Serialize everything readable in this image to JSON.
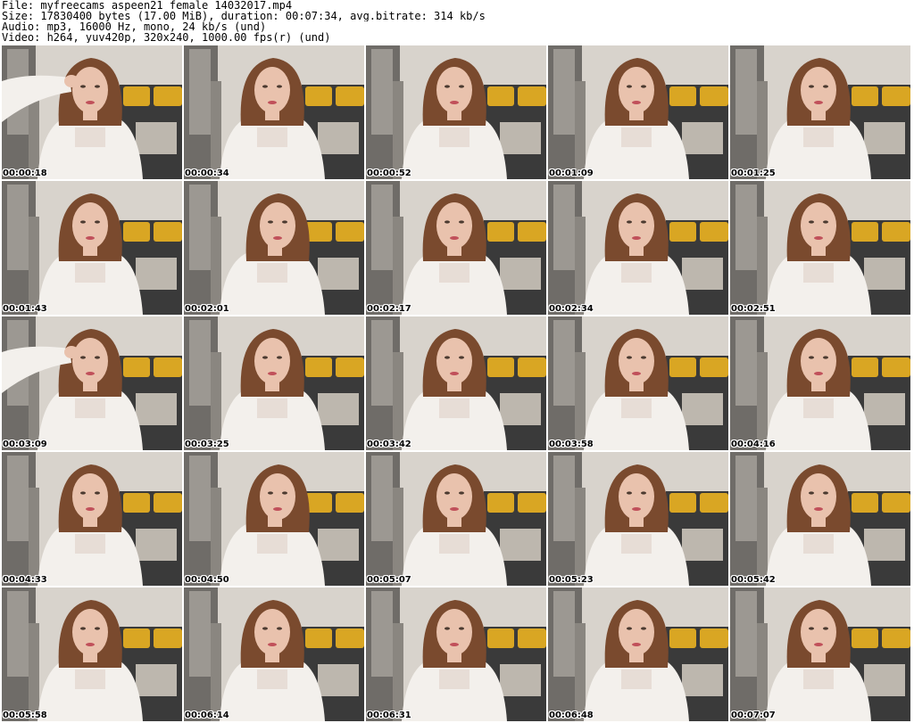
{
  "header": {
    "file_line": "File: myfreecams_aspeen21_female_14032017.mp4",
    "size_line": "Size: 17830400 bytes (17.00 MiB), duration: 00:07:34, avg.bitrate: 314 kb/s",
    "audio_line": "Audio: mp3, 16000 Hz, mono, 24 kb/s (und)",
    "video_line": "Video: h264, yuv420p, 320x240, 1000.00 fps(r) (und)"
  },
  "colors": {
    "wall": "#d8d3cc",
    "cushion": "#d9a623",
    "chair": "#3a3a3a",
    "blouse": "#f3f0ec",
    "hair": "#7a4a2e",
    "skin": "#e9c2ad"
  },
  "thumbnails": [
    {
      "time": "00:00:18",
      "variant": "arm-up"
    },
    {
      "time": "00:00:34",
      "variant": "normal"
    },
    {
      "time": "00:00:52",
      "variant": "normal"
    },
    {
      "time": "00:01:09",
      "variant": "normal"
    },
    {
      "time": "00:01:25",
      "variant": "normal"
    },
    {
      "time": "00:01:43",
      "variant": "normal"
    },
    {
      "time": "00:02:01",
      "variant": "tilt"
    },
    {
      "time": "00:02:17",
      "variant": "normal"
    },
    {
      "time": "00:02:34",
      "variant": "normal"
    },
    {
      "time": "00:02:51",
      "variant": "normal"
    },
    {
      "time": "00:03:09",
      "variant": "arm-up"
    },
    {
      "time": "00:03:25",
      "variant": "normal"
    },
    {
      "time": "00:03:42",
      "variant": "normal"
    },
    {
      "time": "00:03:58",
      "variant": "normal"
    },
    {
      "time": "00:04:16",
      "variant": "normal"
    },
    {
      "time": "00:04:33",
      "variant": "normal"
    },
    {
      "time": "00:04:50",
      "variant": "tilt"
    },
    {
      "time": "00:05:07",
      "variant": "normal"
    },
    {
      "time": "00:05:23",
      "variant": "normal"
    },
    {
      "time": "00:05:42",
      "variant": "normal"
    },
    {
      "time": "00:05:58",
      "variant": "normal"
    },
    {
      "time": "00:06:14",
      "variant": "normal"
    },
    {
      "time": "00:06:31",
      "variant": "normal"
    },
    {
      "time": "00:06:48",
      "variant": "normal"
    },
    {
      "time": "00:07:07",
      "variant": "normal"
    }
  ]
}
